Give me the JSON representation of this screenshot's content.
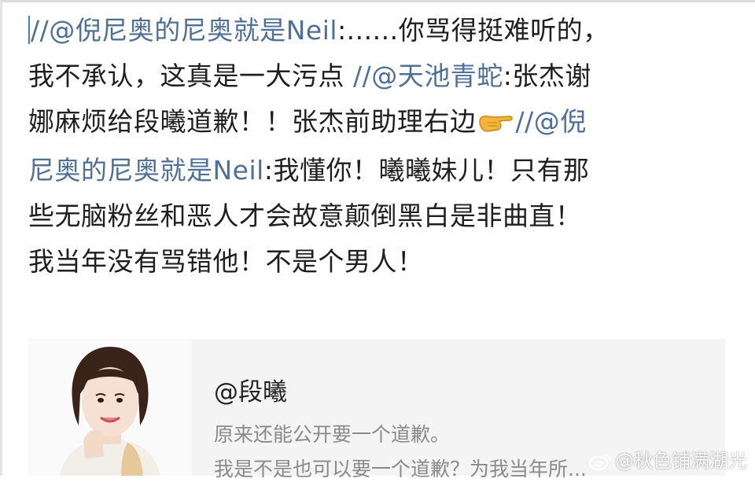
{
  "post": {
    "line1": {
      "mention": "//@倪尼奥的尼奥就是Neil",
      "text": ":......你骂得挺难听的，"
    },
    "line2": {
      "text": "我不承认，这真是一大污点 ",
      "mention": "//@天池青蛇",
      "text2": ":张杰谢"
    },
    "line3": {
      "text": "娜麻烦给段曦道歉！！张杰前助理右边",
      "emoji": "pointing-hand-icon",
      "mention": "//@倪"
    },
    "line4": {
      "mention": "尼奥的尼奥就是Neil",
      "text": ":我懂你！曦曦妹儿！只有那"
    },
    "line5": {
      "text": "些无脑粉丝和恶人才会故意颠倒黑白是非曲直！"
    },
    "line6": {
      "text": "我当年没有骂错他！不是个男人！"
    }
  },
  "quote": {
    "user": "@段曦",
    "line1": "原来还能公开要一个道歉。",
    "line2": "我是不是也可以要一个道歉？为我当年所..."
  },
  "watermark": {
    "text": "@秋色铺满湖光"
  },
  "colors": {
    "mention": "#4f6f95",
    "text": "#1f1f1f",
    "quote_bg": "#f4f4f4",
    "quote_text": "#8a8a8a"
  }
}
